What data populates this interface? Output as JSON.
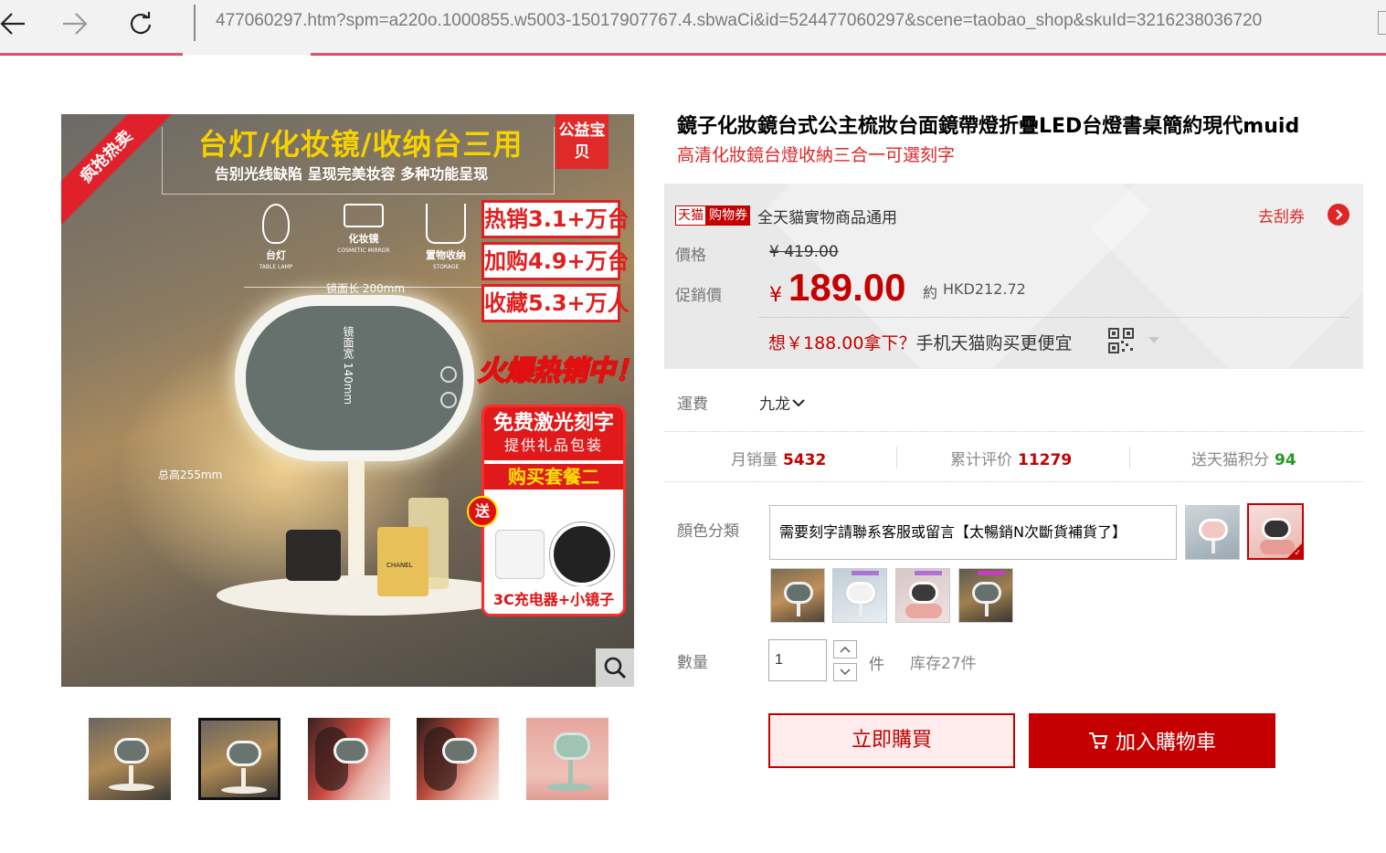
{
  "browser": {
    "url": "477060297.htm?spm=a220o.1000855.w5003-15017907767.4.sbwaCi&id=524477060297&scene=taobao_shop&skuId=3216238036720"
  },
  "main_image": {
    "corner_ribbon": "疯抢热卖",
    "badge": "公益宝贝",
    "headline": "台灯/化妆镜/收纳台三用",
    "subheadline": "告别光线缺陷  呈现完美妆容  多种功能呈现",
    "features": [
      {
        "cn": "台灯",
        "en": "TABLE LAMP"
      },
      {
        "cn": "化妆镜",
        "en": "COSMETIC MIRROR"
      },
      {
        "cn": "置物收纳",
        "en": "STORAGE"
      }
    ],
    "mirror_width": "镜面长 200mm",
    "mirror_height": "镜面宽 140mm",
    "total_height": "总高255mm",
    "perfume_label": "CHANEL",
    "sales_boxes": [
      "热销3.1+万台",
      "加购4.9+万台",
      "收藏5.3+万人"
    ],
    "hot_sale": "火爆热销中！",
    "offer_title": "免费激光刻字",
    "offer_sub": "提供礼品包装",
    "offer_package": "购买套餐二",
    "offer_bottom": "3C充电器+小镜子",
    "gift_tag": "送"
  },
  "product": {
    "title": "鏡子化妝鏡台式公主梳妝台面鏡帶燈折疊LED台燈書桌簡約現代muid",
    "subtitle": "高清化妝鏡台燈收納三合一可選刻字"
  },
  "price_panel": {
    "tag_tmall": "天猫",
    "tag_coupon": "购物券",
    "coupon_text": "全天貓實物商品通用",
    "coupon_link": "去刮券",
    "price_label": "價格",
    "orig_price": "¥ 419.00",
    "promo_label": "促銷價",
    "promo_currency": "¥",
    "promo_price": "189.00",
    "approx_label": "約",
    "approx_value": "HKD212.72",
    "mobile_red": "想￥188.00拿下？",
    "mobile_black": "手机天猫购买更便宜"
  },
  "shipping": {
    "label": "運費",
    "value": "九龙"
  },
  "stats": {
    "monthly_sales_label": "月销量",
    "monthly_sales": "5432",
    "reviews_label": "累计评价",
    "reviews": "11279",
    "points_label": "送天猫积分",
    "points": "94"
  },
  "sku": {
    "label": "顏色分類",
    "selected_text": "需要刻字請聯系客服或留言【太暢銷N次斷貨補貨了】"
  },
  "quantity": {
    "label": "數量",
    "value": "1",
    "unit": "件",
    "stock": "库存27件"
  },
  "actions": {
    "buy_now": "立即購買",
    "add_cart": "加入購物車"
  },
  "colors": {
    "accent": "#c40000",
    "promo_red": "#dd2727",
    "points_green": "#239b23",
    "load_bar": "#e5506b"
  },
  "icons": [
    "back-arrow-icon",
    "forward-arrow-icon",
    "refresh-icon",
    "search-zoom-icon",
    "chevron-right-icon",
    "qr-code-icon",
    "chevron-down-icon",
    "cart-icon"
  ]
}
